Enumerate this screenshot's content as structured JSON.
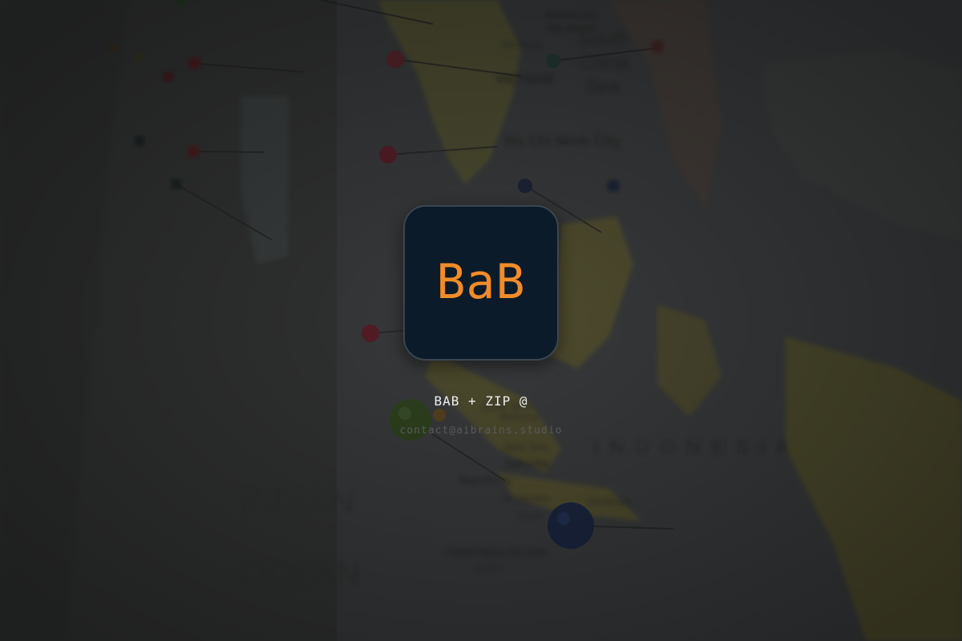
{
  "logo": {
    "text": "BaB"
  },
  "headline": "BAB + ZIP @",
  "contact": {
    "email": "contact@aibrains.studio"
  },
  "colors": {
    "accent": "#f28c28",
    "tile_background": "#0b1b2a",
    "overlay": "#222222"
  },
  "background_map": {
    "labels": [
      "PARACEL ISLANDS",
      "South",
      "China",
      "Sea",
      "VIETNAM",
      "Da Nang",
      "Ho Chi Minh City",
      "Java Sea",
      "Jakarta",
      "Bandung",
      "Surakarta",
      "Surabaya",
      "Java",
      "Belitung",
      "JAVA SEA",
      "CHRISTMAS ISLAND",
      "(Aust.)",
      "INDIAN",
      "OCEAN",
      "INDONESIA"
    ]
  }
}
